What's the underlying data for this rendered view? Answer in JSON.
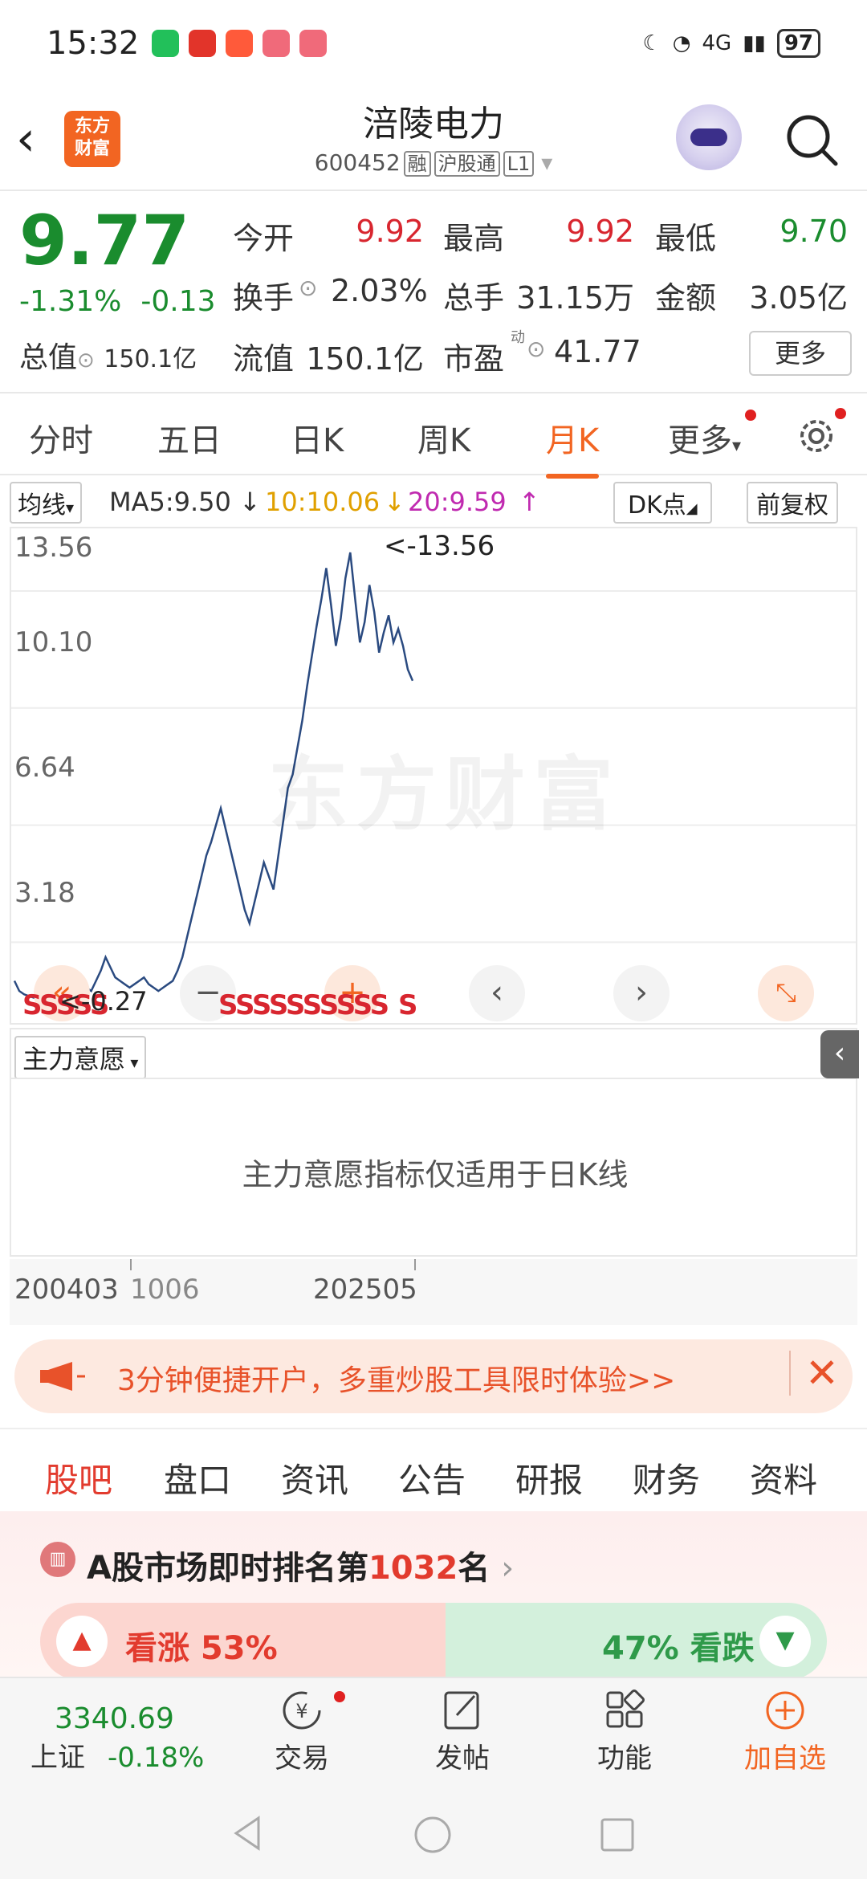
{
  "status": {
    "time": "15:32",
    "battery": "97",
    "network": "4G"
  },
  "header": {
    "logo_line1": "东方",
    "logo_line2": "财富",
    "title": "涪陵电力",
    "code": "600452",
    "tags": [
      "融",
      "沪股通",
      "L1"
    ]
  },
  "quote": {
    "price": "9.77",
    "change_pct": "-1.31%",
    "change_abs": "-0.13",
    "total_cap_label": "总值",
    "total_cap_value": "150.1亿",
    "open_label": "今开",
    "open_value": "9.92",
    "high_label": "最高",
    "high_value": "9.92",
    "low_label": "最低",
    "low_value": "9.70",
    "turnover_label": "换手",
    "turnover_value": "2.03%",
    "volume_label": "总手",
    "volume_value": "31.15万",
    "amount_label": "金额",
    "amount_value": "3.05亿",
    "float_label": "流值",
    "float_value": "150.1亿",
    "pe_label": "市盈",
    "pe_sup": "动",
    "pe_value": "41.77",
    "more_button": "更多"
  },
  "period_tabs": [
    "分时",
    "五日",
    "日K",
    "周K",
    "月K",
    "更多"
  ],
  "active_period": "月K",
  "ma": {
    "label": "均线",
    "ma5": "MA5:9.50",
    "ma10": "10:10.06",
    "ma20": "20:9.59",
    "dk_button": "DK点",
    "fq_button": "前复权"
  },
  "chart": {
    "y_ticks": [
      "13.56",
      "10.10",
      "6.64",
      "3.18"
    ],
    "max_marker": "<-13.56",
    "min_marker": "<-0.27",
    "watermark": "东方财富",
    "signals_left": "SSSSS",
    "signals_mid": "SSSSSSSSSS",
    "signals_right": "S",
    "x_start": "200403",
    "x_mid": "1006",
    "x_end": "202505"
  },
  "chart_data": {
    "type": "line",
    "title": "",
    "ylim": [
      0.27,
      13.56
    ],
    "y_ticks": [
      13.56,
      10.1,
      6.64,
      3.18
    ],
    "x_labels": [
      "200403",
      "202505"
    ],
    "series": [
      {
        "name": "",
        "values": [
          0.9,
          0.6,
          0.5,
          0.45,
          0.4,
          0.35,
          0.3,
          0.27,
          0.35,
          0.5,
          0.7,
          0.6,
          0.5,
          0.55,
          0.8,
          0.7,
          0.6,
          0.9,
          1.2,
          1.6,
          1.3,
          1.0,
          0.9,
          0.8,
          0.7,
          0.8,
          0.9,
          1.0,
          0.8,
          0.7,
          0.6,
          0.7,
          0.8,
          0.9,
          1.2,
          1.6,
          2.2,
          2.8,
          3.4,
          4.0,
          4.6,
          5.0,
          5.5,
          6.0,
          5.4,
          4.8,
          4.2,
          3.6,
          3.0,
          2.6,
          3.2,
          3.8,
          4.4,
          4.0,
          3.6,
          4.6,
          5.6,
          6.6,
          7.0,
          7.8,
          8.6,
          9.6,
          10.5,
          11.4,
          12.2,
          13.1,
          12.0,
          10.8,
          11.6,
          12.8,
          13.56,
          12.2,
          10.9,
          11.5,
          12.6,
          11.8,
          10.6,
          11.2,
          11.7,
          10.9,
          11.3,
          10.8,
          10.1,
          9.77
        ]
      }
    ]
  },
  "indicator": {
    "select_label": "主力意愿",
    "message": "主力意愿指标仅适用于日K线"
  },
  "promo": {
    "text": "3分钟便捷开户，多重炒股工具限时体验>>"
  },
  "content_tabs": [
    "股吧",
    "盘口",
    "资讯",
    "公告",
    "研报",
    "财务",
    "资料"
  ],
  "rank": {
    "prefix": "A股市场即时排名第",
    "number": "1032",
    "suffix": "名"
  },
  "vote": {
    "up_label": "看涨 53%",
    "down_label": "47% 看跌",
    "up_pct": 53,
    "down_pct": 47
  },
  "bottom_bar": {
    "index_value": "3340.69",
    "index_name": "上证",
    "index_change": "-0.18%",
    "items": [
      "交易",
      "发帖",
      "功能",
      "加自选"
    ]
  }
}
